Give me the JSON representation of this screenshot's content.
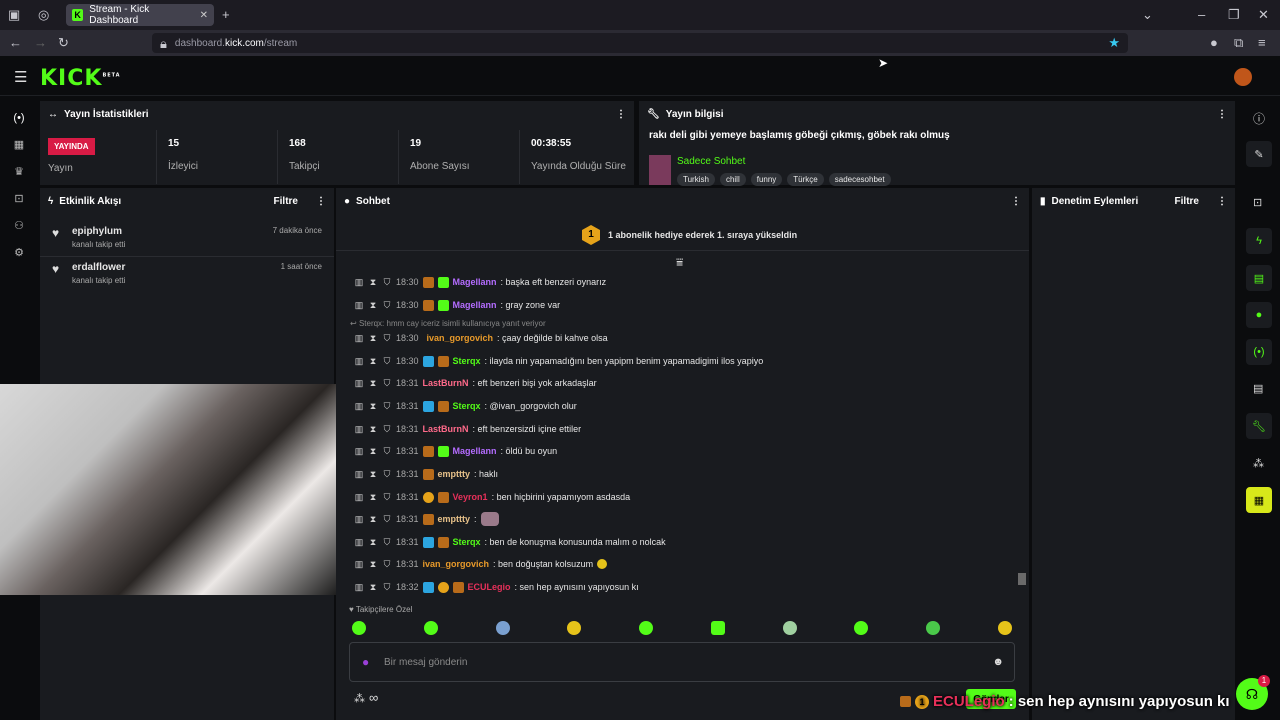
{
  "browser": {
    "tab_title": "Stream - Kick Dashboard",
    "url_domain_prefix": "dashboard.",
    "url_domain": "kick.com",
    "url_path": "/stream"
  },
  "app": {
    "logo": "KICK",
    "logo_sup": "BETA"
  },
  "stats": {
    "title": "Yayın İstatistikleri",
    "live_badge": "YAYINDA",
    "live_label": "Yayın",
    "items": [
      {
        "value": "15",
        "label": "İzleyici"
      },
      {
        "value": "168",
        "label": "Takipçi"
      },
      {
        "value": "19",
        "label": "Abone Sayısı"
      },
      {
        "value": "00:38:55",
        "label": "Yayında Olduğu Süre"
      }
    ]
  },
  "info": {
    "title": "Yayın bilgisi",
    "stream_title": "rakı deli gibi yemeye başlamış göbeği çıkmış, göbek rakı olmuş",
    "category": "Sadece Sohbet",
    "tags": [
      "Turkish",
      "chill",
      "funny",
      "Türkçe",
      "sadecesohbet"
    ]
  },
  "activity": {
    "title": "Etkinlik Akışı",
    "filter": "Filtre",
    "items": [
      {
        "user": "epiphylum",
        "action": "kanalı takip etti",
        "time": "7 dakika önce"
      },
      {
        "user": "erdalflower",
        "action": "kanalı takip etti",
        "time": "1 saat önce"
      }
    ]
  },
  "chat": {
    "title": "Sohbet",
    "pinned_badge": "1",
    "pinned": "1 abonelik hediye ederek 1. sıraya yükseldin",
    "reply_note": "Sterqx: hmm cay iceriz isimli kullanıcıya yanıt veriyor",
    "messages": [
      {
        "time": "18:30",
        "user": "Magellann",
        "color": "#b46cff",
        "text": ": başka eft benzeri oynarız"
      },
      {
        "time": "18:30",
        "user": "Magellann",
        "color": "#b46cff",
        "text": ": gray zone var"
      },
      {
        "time": "18:30",
        "user": "ivan_gorgovich",
        "color": "#e89a2a",
        "text": ": çaay değilde bi kahve olsa"
      },
      {
        "time": "18:30",
        "user": "Sterqx",
        "color": "#53fc18",
        "text": ": ilayda nin yapamadığını ben yapipm benim yapamadigimi ilos yapiyo"
      },
      {
        "time": "18:31",
        "user": "LastBurnN",
        "color": "#ff6a8a",
        "text": ": eft benzeri bişi yok arkadaşlar"
      },
      {
        "time": "18:31",
        "user": "Sterqx",
        "color": "#53fc18",
        "text": ": @ivan_gorgovich olur"
      },
      {
        "time": "18:31",
        "user": "LastBurnN",
        "color": "#ff6a8a",
        "text": ": eft benzersizdi içine ettiler"
      },
      {
        "time": "18:31",
        "user": "Magellann",
        "color": "#b46cff",
        "text": ": öldü bu oyun"
      },
      {
        "time": "18:31",
        "user": "empttty",
        "color": "#e8c28a",
        "text": ": haklı"
      },
      {
        "time": "18:31",
        "user": "Veyron1",
        "color": "#e8305a",
        "text": ": ben hiçbirini yapamıyom asdasda"
      },
      {
        "time": "18:31",
        "user": "empttty",
        "color": "#e8c28a",
        "text": ":"
      },
      {
        "time": "18:31",
        "user": "Sterqx",
        "color": "#53fc18",
        "text": ": ben de konuşma konusunda malım o nolcak"
      },
      {
        "time": "18:31",
        "user": "ivan_gorgovich",
        "color": "#e89a2a",
        "text": ": ben doğuştan kolsuzum"
      },
      {
        "time": "18:32",
        "user": "ECULegio",
        "color": "#e8305a",
        "text": ": sen hep aynısını yapıyosun kı"
      }
    ],
    "followers_only": "Takipçilere Özel",
    "placeholder": "Bir mesaj gönderin",
    "send": "Gönder"
  },
  "moderation": {
    "title": "Denetim Eylemleri",
    "filter": "Filtre"
  },
  "overlay": {
    "user": "ECULegio",
    "text": ": sen hep aynısını yapıyosun kı",
    "gift": "1"
  },
  "notification_count": "1",
  "colors": {
    "accent": "#53fc18",
    "live": "#d81b45"
  }
}
